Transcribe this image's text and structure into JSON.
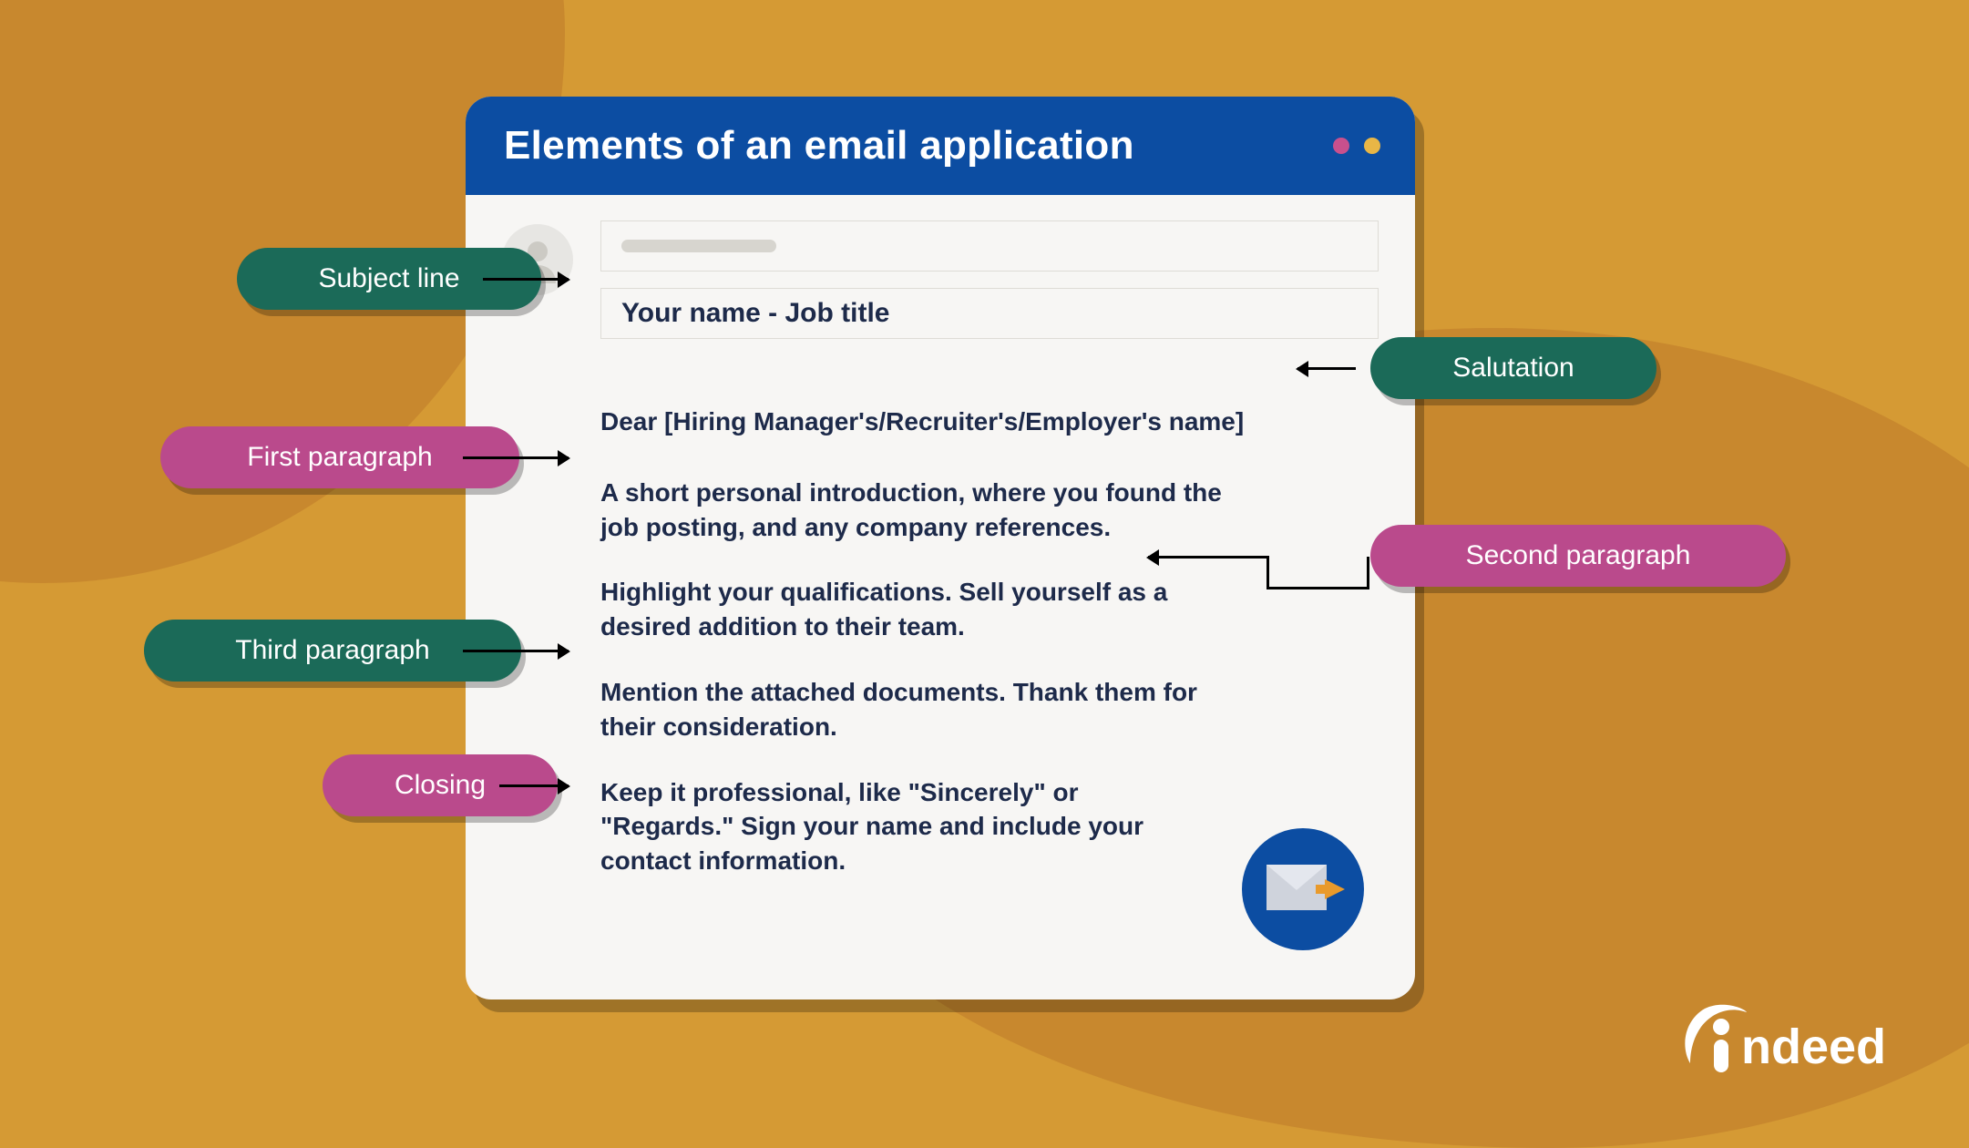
{
  "header": {
    "title": "Elements of an email application"
  },
  "email": {
    "subject": "Your name - Job title",
    "salutation": "Dear [Hiring Manager's/Recruiter's/Employer's name]",
    "first_paragraph": "A short personal introduction, where you found the job posting, and any company references.",
    "second_paragraph": "Highlight your qualifications. Sell yourself as a desired addition to their team.",
    "third_paragraph": "Mention the attached documents. Thank them for their consideration.",
    "closing": "Keep it professional, like \"Sincerely\" or \"Regards.\" Sign your name and include your contact information."
  },
  "labels": {
    "subject": "Subject line",
    "salutation": "Salutation",
    "first": "First paragraph",
    "second": "Second paragraph",
    "third": "Third paragraph",
    "closing": "Closing"
  },
  "brand": "indeed",
  "colors": {
    "bg": "#d59a34",
    "bg_dark": "#c8882e",
    "card": "#f7f6f4",
    "header": "#0c4da2",
    "green": "#1b6a58",
    "magenta": "#ba4a8c",
    "text": "#1d2a4a"
  }
}
